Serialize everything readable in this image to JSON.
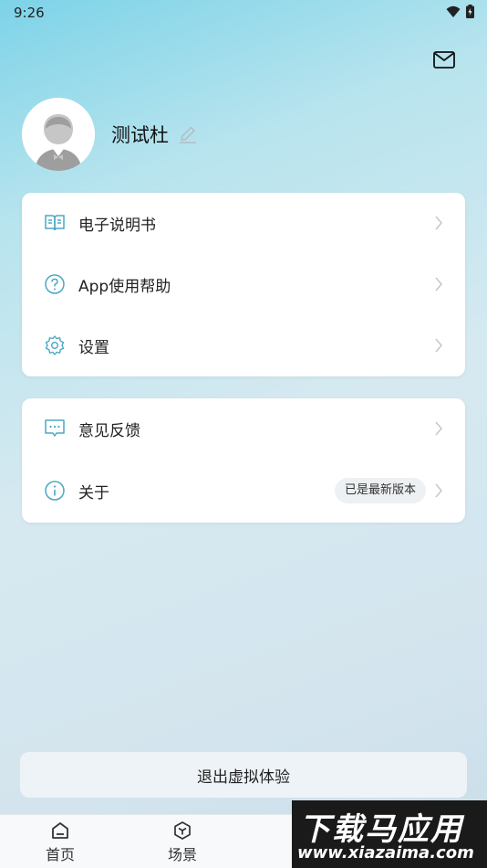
{
  "status_bar": {
    "time": "9:26"
  },
  "profile": {
    "username": "测试杜"
  },
  "menu_group_1": [
    {
      "label": "电子说明书",
      "icon": "book-icon"
    },
    {
      "label": "App使用帮助",
      "icon": "help-circle-icon"
    },
    {
      "label": "设置",
      "icon": "gear-icon"
    }
  ],
  "menu_group_2": [
    {
      "label": "意见反馈",
      "icon": "chat-icon"
    },
    {
      "label": "关于",
      "icon": "info-icon",
      "badge": "已是最新版本"
    }
  ],
  "logout_label": "退出虚拟体验",
  "tabs": [
    {
      "label": "首页",
      "icon": "home-icon"
    },
    {
      "label": "场景",
      "icon": "cube-icon"
    }
  ],
  "watermark": {
    "title": "下载马应用",
    "url": "www.xiazaima.com"
  },
  "colors": {
    "accent_icon": "#4aa8c4",
    "card_bg": "#ffffff",
    "badge_bg": "#eef1f3"
  }
}
